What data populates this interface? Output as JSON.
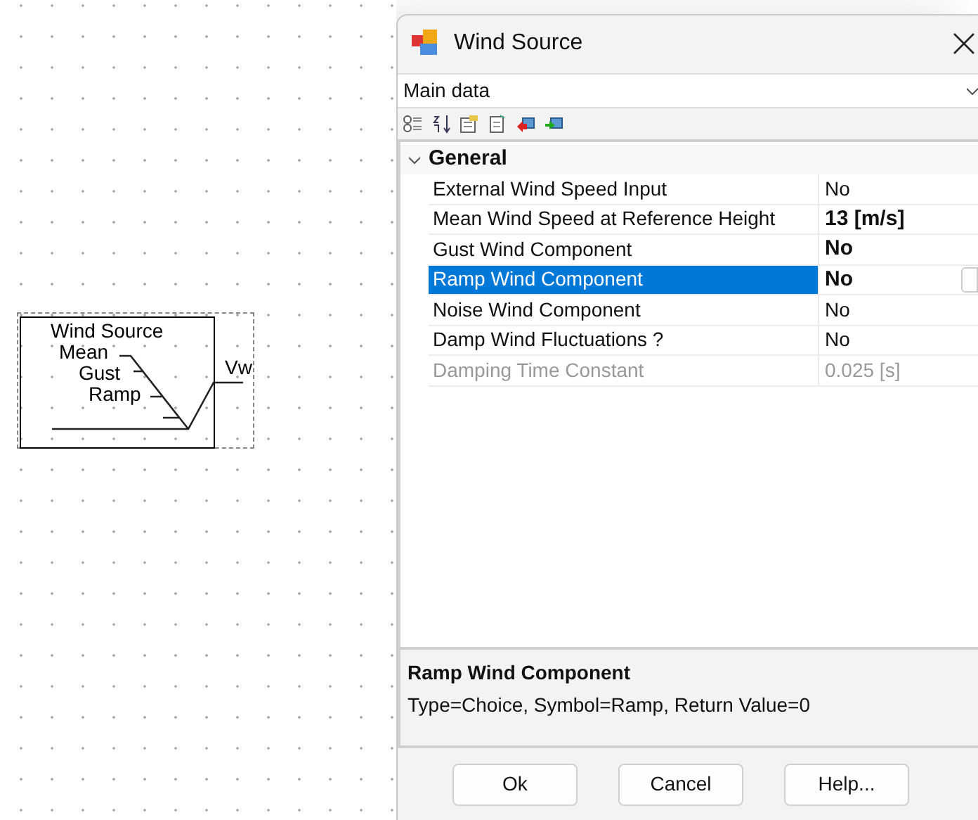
{
  "diagram": {
    "block_title": "Wind Source",
    "inputs": [
      "Mean",
      "Gust",
      "Ramp"
    ],
    "output": "Vw",
    "selected": true
  },
  "dialog": {
    "title": "Wind Source",
    "section_dropdown": {
      "value": "Main data"
    },
    "group": {
      "label": "General",
      "expanded": true,
      "properties": [
        {
          "name": "External Wind Speed Input",
          "value": "No",
          "modified": false,
          "disabled": false,
          "selected": false
        },
        {
          "name": "Mean Wind Speed at Reference Height",
          "value": "13 [m/s]",
          "modified": true,
          "disabled": false,
          "selected": false
        },
        {
          "name": "Gust Wind Component",
          "value": "No",
          "modified": true,
          "disabled": false,
          "selected": false
        },
        {
          "name": "Ramp Wind Component",
          "value": "No",
          "modified": true,
          "disabled": false,
          "selected": true
        },
        {
          "name": "Noise Wind Component",
          "value": "No",
          "modified": false,
          "disabled": false,
          "selected": false
        },
        {
          "name": "Damp Wind Fluctuations ?",
          "value": "No",
          "modified": false,
          "disabled": false,
          "selected": false
        },
        {
          "name": "Damping Time Constant",
          "value": "0.025 [s]",
          "modified": false,
          "disabled": true,
          "selected": false
        }
      ]
    },
    "description": {
      "title": "Ramp Wind Component",
      "text": "Type=Choice, Symbol=Ramp, Return Value=0"
    },
    "buttons": [
      "Ok",
      "Cancel",
      "Help..."
    ]
  }
}
